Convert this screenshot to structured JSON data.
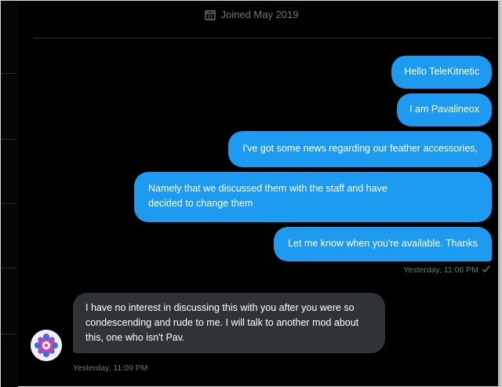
{
  "header": {
    "joined_text": "Joined May 2019",
    "icon": "calendar-icon"
  },
  "messages": [
    {
      "direction": "sent",
      "text": "Hello TeleKitnetic"
    },
    {
      "direction": "sent",
      "text": "I am Pavalineox"
    },
    {
      "direction": "sent",
      "text": "I've got some news regarding our feather accessories,"
    },
    {
      "direction": "sent",
      "text_lines": [
        "Namely that we discussed them with the staff and have",
        "decided to change them"
      ]
    },
    {
      "direction": "sent",
      "text": "Let me know when you're available. Thanks"
    },
    {
      "direction": "received",
      "text": "I have no interest in discussing this with you after you were so condescending and rude to me. I will talk to another mod about this, one who isn't Pav."
    }
  ],
  "sent_timestamp": "Yesterday, 11:06 PM",
  "sent_status_icon": "checkmark-icon",
  "received_timestamp": "Yesterday, 11:09 PM",
  "colors": {
    "background": "#000000",
    "sent_bubble": "#1d9bf0",
    "received_bubble": "#2f3336",
    "meta_text": "#6e767d",
    "divider": "#2f3336"
  }
}
